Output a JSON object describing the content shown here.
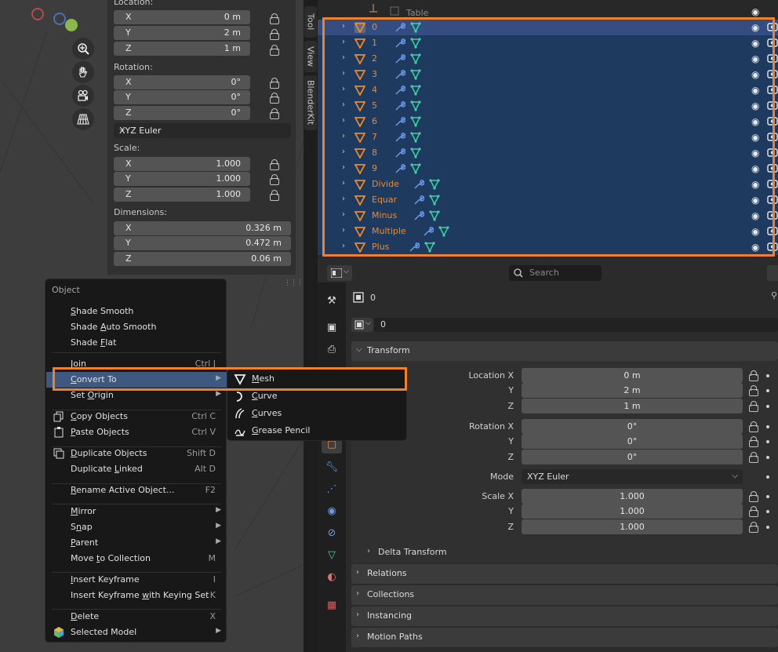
{
  "npanel": {
    "location_label": "Location:",
    "location": [
      {
        "axis": "X",
        "value": "0 m"
      },
      {
        "axis": "Y",
        "value": "2 m"
      },
      {
        "axis": "Z",
        "value": "1 m"
      }
    ],
    "rotation_label": "Rotation:",
    "rotation": [
      {
        "axis": "X",
        "value": "0°"
      },
      {
        "axis": "Y",
        "value": "0°"
      },
      {
        "axis": "Z",
        "value": "0°"
      }
    ],
    "rotation_mode": "XYZ Euler",
    "scale_label": "Scale:",
    "scale": [
      {
        "axis": "X",
        "value": "1.000"
      },
      {
        "axis": "Y",
        "value": "1.000"
      },
      {
        "axis": "Z",
        "value": "1.000"
      }
    ],
    "dimensions_label": "Dimensions:",
    "dimensions": [
      {
        "axis": "X",
        "value": "0.326 m"
      },
      {
        "axis": "Y",
        "value": "0.472 m"
      },
      {
        "axis": "Z",
        "value": "0.06 m"
      }
    ]
  },
  "side_tabs": [
    "Tool",
    "View",
    "BlenderKit"
  ],
  "outliner": {
    "partial_item": "Table",
    "items": [
      {
        "name": "0"
      },
      {
        "name": "1"
      },
      {
        "name": "2"
      },
      {
        "name": "3"
      },
      {
        "name": "4"
      },
      {
        "name": "5"
      },
      {
        "name": "6"
      },
      {
        "name": "7"
      },
      {
        "name": "8"
      },
      {
        "name": "9"
      },
      {
        "name": "Divide"
      },
      {
        "name": "Equar"
      },
      {
        "name": "Minus"
      },
      {
        "name": "Multiple"
      },
      {
        "name": "Plus"
      }
    ]
  },
  "properties": {
    "search_placeholder": "Search",
    "object_name": "0",
    "data_name": "0",
    "transform_label": "Transform",
    "location_labels": [
      "Location X",
      "Y",
      "Z"
    ],
    "location_values": [
      "0 m",
      "2 m",
      "1 m"
    ],
    "rotation_labels": [
      "Rotation X",
      "Y",
      "Z"
    ],
    "rotation_values": [
      "0°",
      "0°",
      "0°"
    ],
    "mode_label": "Mode",
    "mode_value": "XYZ Euler",
    "scale_labels": [
      "Scale X",
      "Y",
      "Z"
    ],
    "scale_values": [
      "1.000",
      "1.000",
      "1.000"
    ],
    "delta_transform": "Delta Transform",
    "panels": [
      "Relations",
      "Collections",
      "Instancing",
      "Motion Paths"
    ]
  },
  "context_menu": {
    "title": "Object",
    "items": [
      {
        "label": "Shade Smooth",
        "u": "S",
        "rest": "hade Smooth",
        "shortcut": ""
      },
      {
        "label": "Shade Auto Smooth",
        "pre": "Shade ",
        "u": "A",
        "rest": "uto Smooth",
        "shortcut": ""
      },
      {
        "label": "Shade Flat",
        "pre": "Shade ",
        "u": "F",
        "rest": "lat",
        "shortcut": ""
      },
      {
        "label": "Join",
        "u": "J",
        "rest": "oin",
        "shortcut": "Ctrl J"
      },
      {
        "label": "Convert To",
        "u": "C",
        "rest": "onvert To",
        "shortcut": ""
      },
      {
        "label": "Set Origin",
        "pre": "Set ",
        "u": "O",
        "rest": "rigin",
        "shortcut": ""
      },
      {
        "label": "Copy Objects",
        "u": "C",
        "rest": "opy Objects",
        "shortcut": "Ctrl C"
      },
      {
        "label": "Paste Objects",
        "u": "P",
        "rest": "aste Objects",
        "shortcut": "Ctrl V"
      },
      {
        "label": "Duplicate Objects",
        "u": "D",
        "rest": "uplicate Objects",
        "shortcut": "Shift D"
      },
      {
        "label": "Duplicate Linked",
        "pre": "Duplicate ",
        "u": "L",
        "rest": "inked",
        "shortcut": "Alt D"
      },
      {
        "label": "Rename Active Object...",
        "u": "R",
        "rest": "ename Active Object...",
        "shortcut": "F2"
      },
      {
        "label": "Mirror",
        "u": "M",
        "rest": "irror",
        "shortcut": ""
      },
      {
        "label": "Snap",
        "pre": "S",
        "u": "n",
        "rest": "ap",
        "shortcut": ""
      },
      {
        "label": "Parent",
        "u": "P",
        "rest": "arent",
        "shortcut": ""
      },
      {
        "label": "Move to Collection",
        "pre": "Move ",
        "u": "t",
        "rest": "o Collection",
        "shortcut": "M"
      },
      {
        "label": "Insert Keyframe",
        "u": "I",
        "rest": "nsert Keyframe",
        "shortcut": "I"
      },
      {
        "label": "Insert Keyframe with Keying Set",
        "pre": "Insert Keyframe ",
        "u": "w",
        "rest": "ith Keying Set",
        "shortcut": "K"
      },
      {
        "label": "Delete",
        "u": "D",
        "rest": "elete",
        "shortcut": "X"
      },
      {
        "label": "Selected Model",
        "pre": "",
        "u": "",
        "rest": "Selected Model",
        "shortcut": ""
      }
    ]
  },
  "convert_submenu": [
    {
      "u": "M",
      "rest": "esh"
    },
    {
      "u": "C",
      "rest": "urve"
    },
    {
      "u": "C",
      "rest": "urves"
    },
    {
      "u": "G",
      "rest": "rease Pencil"
    }
  ],
  "colors": {
    "accent_orange": "#f0812a",
    "object_orange": "#ee8a2a",
    "selection_blue": "#1f3a5f",
    "highlight_blue": "#3e5980"
  }
}
